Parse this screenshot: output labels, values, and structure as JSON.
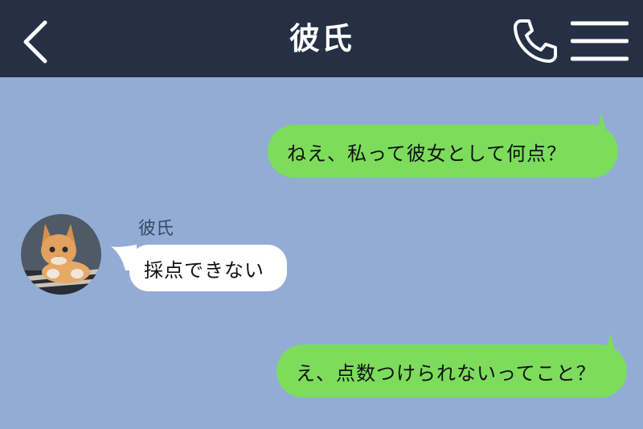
{
  "header": {
    "title": "彼氏",
    "back_icon": "chevron-left-icon",
    "call_icon": "phone-icon",
    "menu_icon": "hamburger-menu-icon"
  },
  "colors": {
    "header_bg": "#253045",
    "chat_bg": "#93acd6",
    "sent_bubble": "#7ddc5c",
    "received_bubble": "#ffffff"
  },
  "messages": [
    {
      "from": "me",
      "text": "ねえ、私って彼女として何点？"
    },
    {
      "from": "彼氏",
      "text": "採点できない"
    },
    {
      "from": "me",
      "text": "え、点数つけられないってこと？"
    }
  ],
  "contact": {
    "name": "彼氏",
    "avatar": "kitten-avatar"
  }
}
